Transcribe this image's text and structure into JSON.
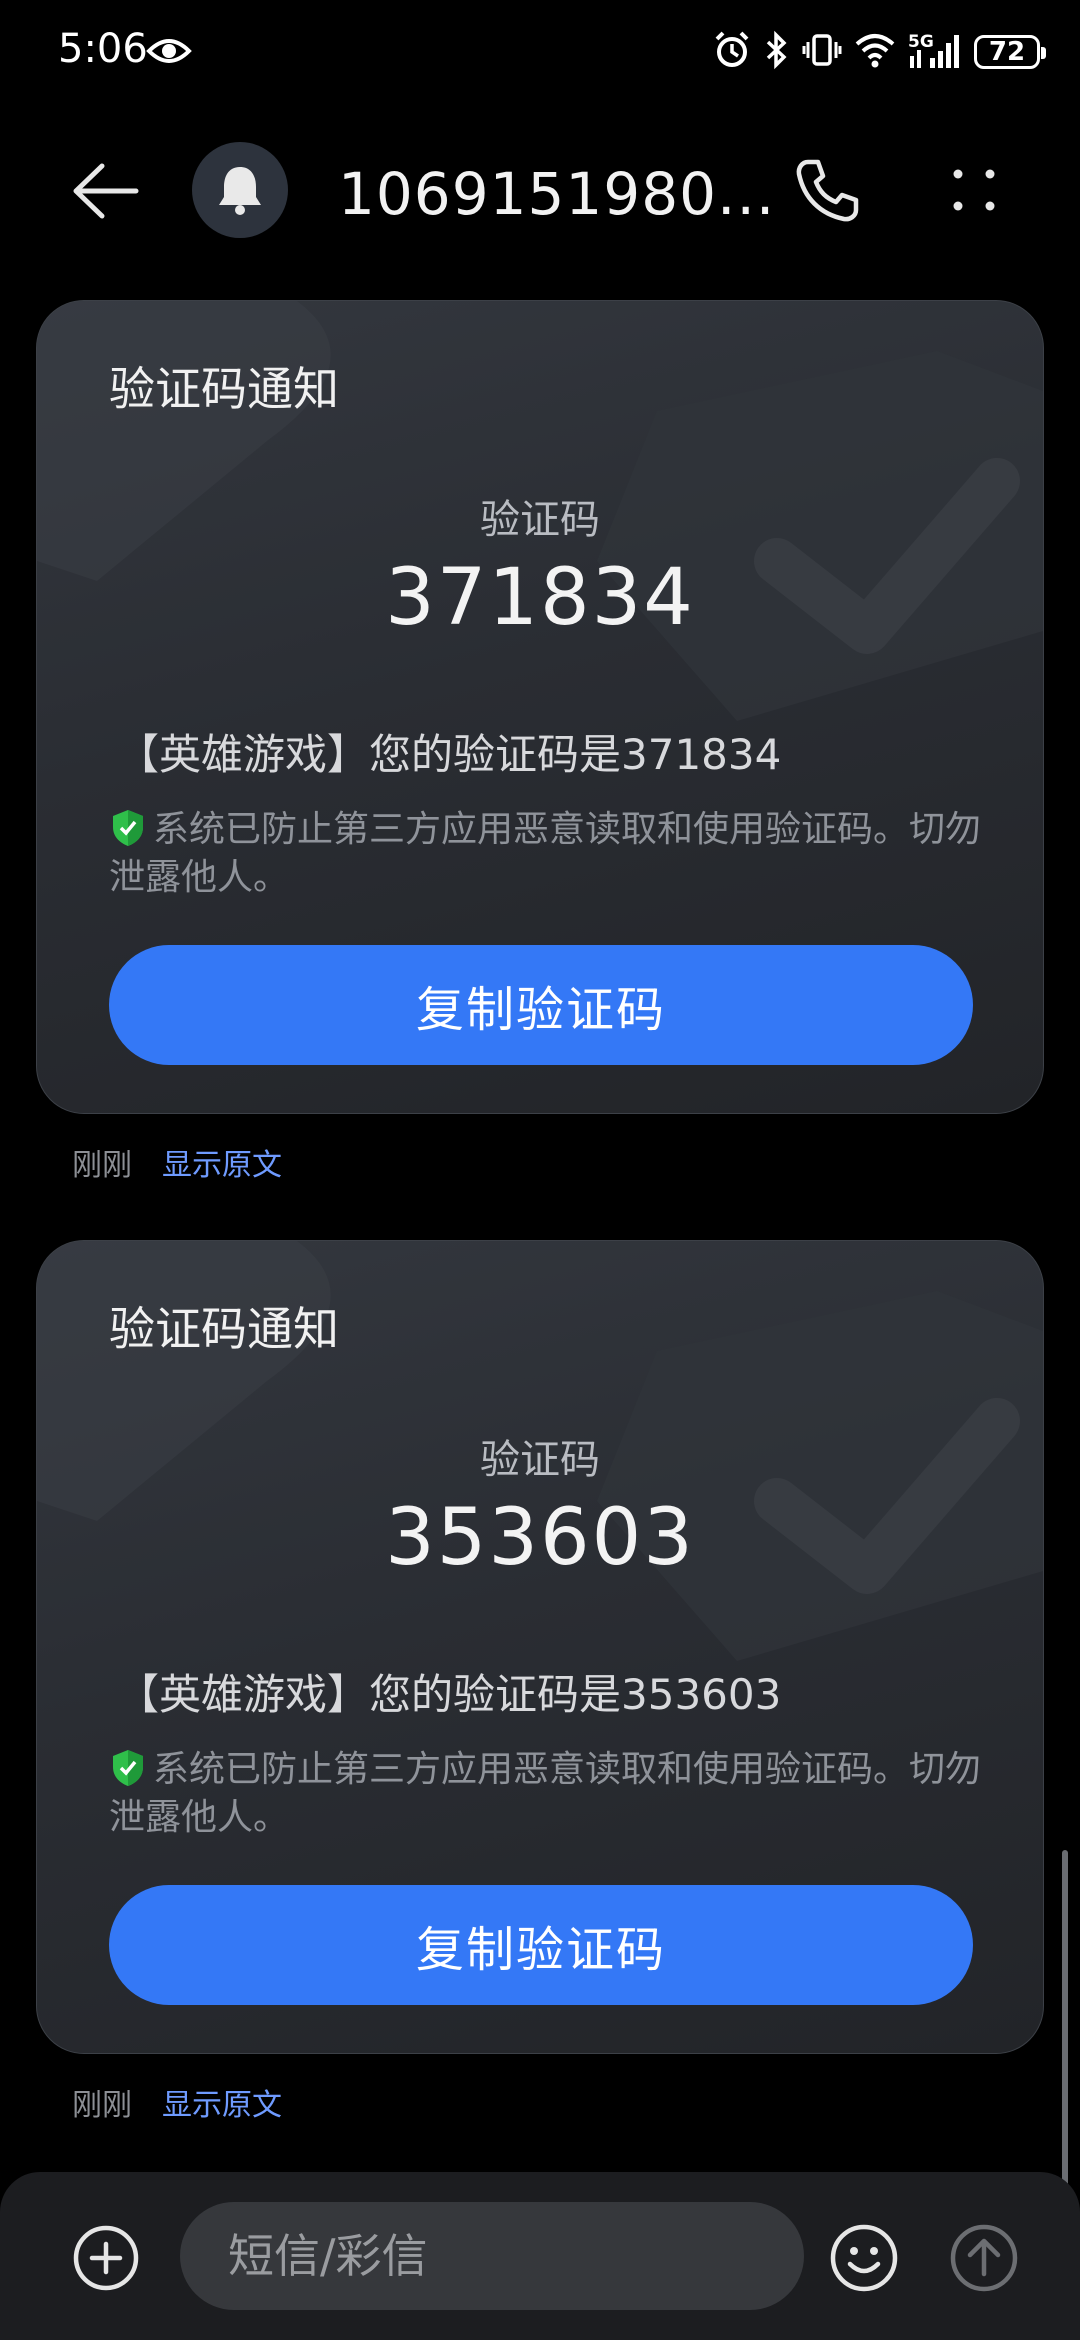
{
  "status_bar": {
    "time": "5:06",
    "network": "5G",
    "battery": "72"
  },
  "header": {
    "sender": "1069151980..."
  },
  "messages": [
    {
      "title": "验证码通知",
      "code_label": "验证码",
      "code": "371834",
      "text": "【英雄游戏】您的验证码是371834",
      "safety_note": "系统已防止第三方应用恶意读取和使用验证码。切勿泄露他人。",
      "copy_label": "复制验证码",
      "time": "刚刚",
      "show_original": "显示原文"
    },
    {
      "title": "验证码通知",
      "code_label": "验证码",
      "code": "353603",
      "text": "【英雄游戏】您的验证码是353603",
      "safety_note": "系统已防止第三方应用恶意读取和使用验证码。切勿泄露他人。",
      "copy_label": "复制验证码",
      "time": "刚刚",
      "show_original": "显示原文"
    }
  ],
  "composer": {
    "placeholder": "短信/彩信"
  },
  "colors": {
    "accent": "#3478f6",
    "link": "#6f9bff",
    "shield": "#2fbf4a",
    "background": "#000000"
  }
}
